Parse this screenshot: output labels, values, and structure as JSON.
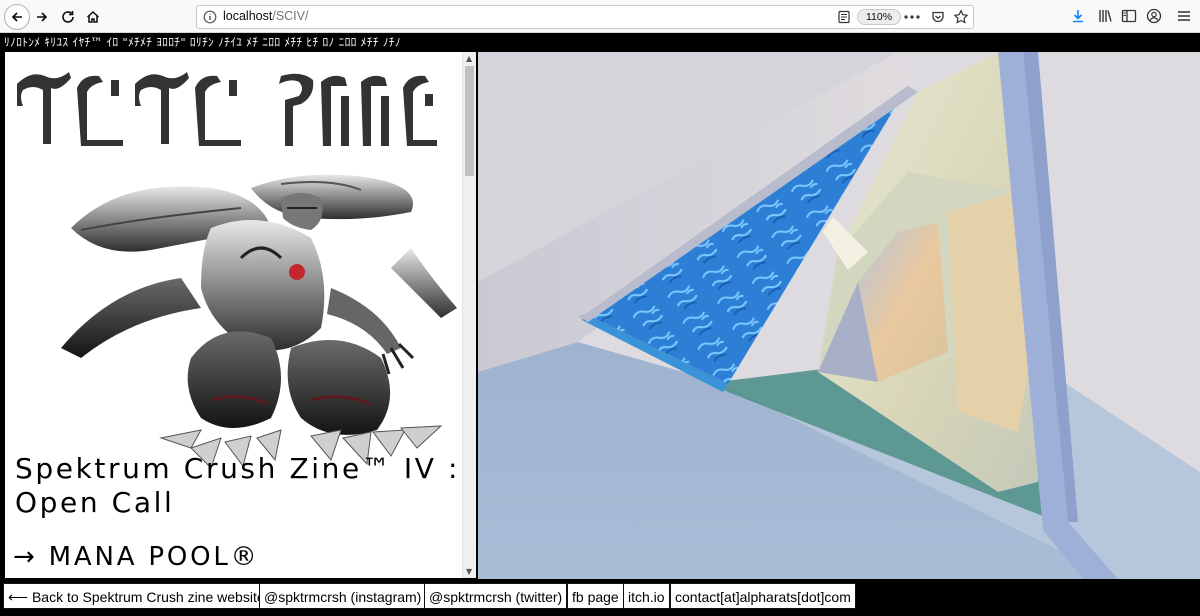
{
  "browser": {
    "url_host": "localhost",
    "url_path": "/SCIV/",
    "zoom": "110%"
  },
  "page": {
    "banner_text": "ﾘﾉﾛﾄﾝﾒ ｷﾘﾕｽ ｲﾔﾁ™ ｲﾛ \"ﾒﾁﾒﾁ ﾖﾛﾛﾁ\" ﾛﾘﾁﾝ ﾉﾁｲﾕ ﾒﾁ ﾆﾛﾛ ﾒﾁﾁ ﾋﾁ ﾛﾉ ﾆﾛﾛ ﾒﾁﾁ ﾉﾁﾉ",
    "zine_title": "Spektrum Crush Zine™ IV : Open Call",
    "mana_link": "→ MANA POOL®"
  },
  "links": [
    {
      "label": "⟵ Back to Spektrum Crush zine website"
    },
    {
      "label": "@spktrmcrsh (instagram)"
    },
    {
      "label": "@spktrmcrsh (twitter)"
    },
    {
      "label": "fb page"
    },
    {
      "label": "itch.io"
    },
    {
      "label": "contact[at]alpharats[dot]com"
    }
  ],
  "colors": {
    "accent_download": "#0a84ff",
    "water_blue": "#2d7fd6"
  }
}
